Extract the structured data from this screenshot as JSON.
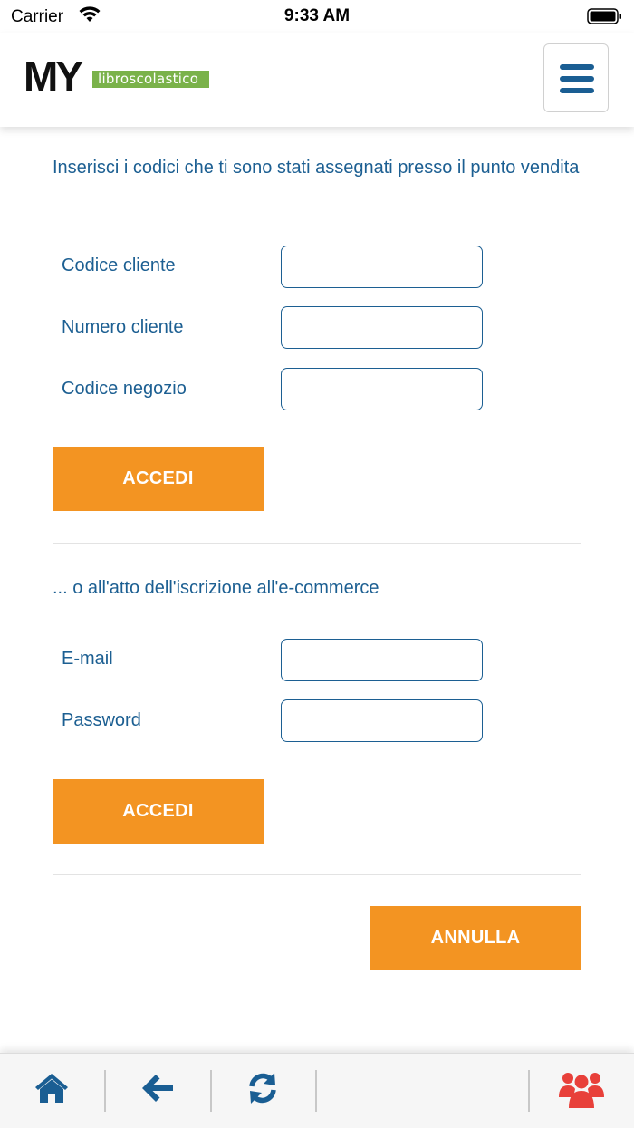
{
  "status_bar": {
    "carrier": "Carrier",
    "time": "9:33 AM"
  },
  "header": {
    "logo_main": "MY",
    "logo_tag": "libroscolastico"
  },
  "section_codes": {
    "intro": "Inserisci i codici che ti sono stati assegnati presso il punto vendita",
    "fields": [
      {
        "label": "Codice cliente",
        "value": ""
      },
      {
        "label": "Numero cliente",
        "value": ""
      },
      {
        "label": "Codice negozio",
        "value": ""
      }
    ],
    "submit_label": "ACCEDI"
  },
  "section_ecommerce": {
    "intro": "... o all'atto dell'iscrizione all'e-commerce",
    "fields": [
      {
        "label": "E-mail",
        "value": ""
      },
      {
        "label": "Password",
        "value": ""
      }
    ],
    "submit_label": "ACCEDI"
  },
  "cancel_label": "ANNULLA",
  "colors": {
    "accent": "#f39422",
    "text": "#1c5f92",
    "logo_green": "#7ab24a",
    "community": "#e8403a"
  },
  "tabbar": {
    "icons": [
      "home-icon",
      "back-arrow-icon",
      "refresh-icon",
      "users-icon"
    ]
  }
}
